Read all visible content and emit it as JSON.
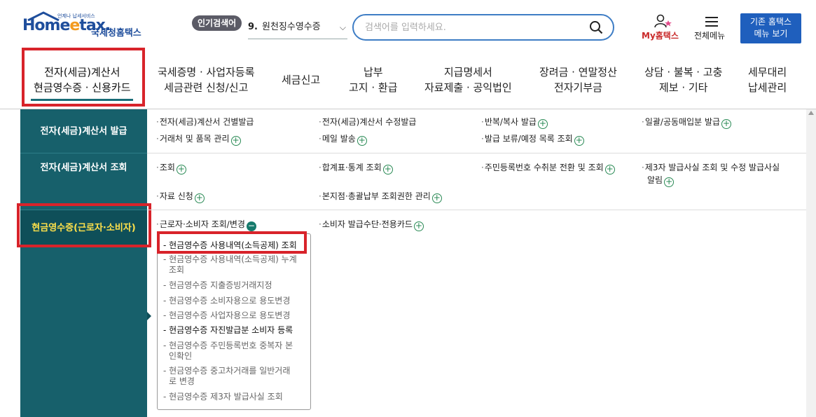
{
  "header": {
    "logo_text_main": "Home",
    "logo_text_e": "e",
    "logo_text_tail": "tax.",
    "logo_korean": "국세청홈택스",
    "logo_tagline": "언제나 납세서비스",
    "popular_badge": "인기검색어",
    "popular_num": "9.",
    "popular_term": "원천징수영수증",
    "search_placeholder": "검색어를 입력하세요.",
    "mytax_label": "My홈택스",
    "allmenu_label": "전체메뉴",
    "classic_line1": "기존 홈택스",
    "classic_line2": "메뉴 보기"
  },
  "gnb": [
    {
      "line1": "전자(세금)계산서",
      "line2": "현금영수증 · 신용카드"
    },
    {
      "line1": "국세증명 · 사업자등록",
      "line2": "세금관련 신청/신고"
    },
    {
      "line1": "세금신고",
      "line2": ""
    },
    {
      "line1": "납부",
      "line2": "고지 · 환급"
    },
    {
      "line1": "지급명세서",
      "line2": "자료제출 · 공익법인"
    },
    {
      "line1": "장려금 · 연말정산",
      "line2": "전자기부금"
    },
    {
      "line1": "상담 · 불복 · 고충",
      "line2": "제보 · 기타"
    },
    {
      "line1": "세무대리",
      "line2": "납세관리"
    }
  ],
  "left": [
    {
      "label": "전자(세금)계산서 발급"
    },
    {
      "label": "전자(세금)계산서 조회"
    },
    {
      "label": "현금영수증(근로자·소비자)"
    }
  ],
  "row1": [
    "전자(세금)계산서 건별발급",
    "전자(세금)계산서 수정발급",
    "반복/복사 발급",
    "일괄/공동매입분 발급",
    "거래처 및 품목 관리",
    "메일 발송",
    "발급 보류/예정 목록 조회"
  ],
  "row2": [
    "조회",
    "합계표·통계 조회",
    "주민등록번호 수취분 전환 및 조회",
    "제3자 발급사실 조회 및 수정 발급사실",
    "알림",
    "자료 신청",
    "본지점·총괄납부 조회권한 관리"
  ],
  "row3": [
    "근로자·소비자 조회/변경",
    "소비자 발급수단·전용카드"
  ],
  "submenu": [
    "- 현금영수증 사용내역(소득공제) 조회",
    "- 현금영수증 사용내역(소득공제) 누계",
    "조회",
    "- 현금영수증 지출증빙거래지정",
    "- 현금영수증 소비자용으로 용도변경",
    "- 현금영수증 사업자용으로 용도변경",
    "- 현금영수증 자진발급분 소비자 등록",
    "- 현금영수증 주민등록번호 중복자 본",
    "인확인",
    "- 현금영수증 중고차거래를 일반거래",
    "로 변경",
    "- 현금영수증 제3자 발급사실 조회"
  ],
  "colors": {
    "teal": "#17606b",
    "highlight": "#ffe14a",
    "red": "#d8232a",
    "blue": "#1f5fbd"
  }
}
